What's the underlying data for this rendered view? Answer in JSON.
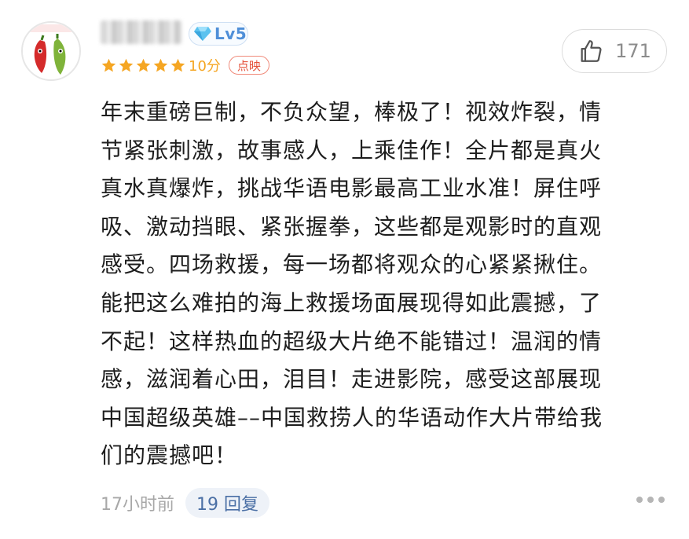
{
  "user": {
    "level": "Lv5",
    "score_text": "10分",
    "tag": "点映",
    "stars": 5
  },
  "like": {
    "count": "171",
    "icon": "thumbs-up-icon"
  },
  "comment": {
    "lines": [
      "年末重磅巨制，不负众望，棒极了！视效炸裂，情",
      "节紧张刺激，故事感人，上乘佳作！全片都是真火",
      "真水真爆炸，挑战华语电影最高工业水准！屏住呼",
      "吸、激动挡眼、紧张握拳，这些都是观影时的直观",
      "感受。四场救援，每一场都将观众的心紧紧揪住。",
      "能把这么难拍的海上救援场面展现得如此震撼，了",
      "不起！这样热血的超级大片绝不能错过！温润的情",
      "感，滋润着心田，泪目！走进影院，感受这部展现",
      "中国超级英雄––中国救捞人的华语动作大片带给我",
      "们的震撼吧！"
    ]
  },
  "footer": {
    "time": "17小时前",
    "reply_label": "19 回复"
  },
  "colors": {
    "star": "#f5a623",
    "level": "#4f8fd8",
    "tag": "#e5533d",
    "reply_text": "#4a6fa5"
  }
}
